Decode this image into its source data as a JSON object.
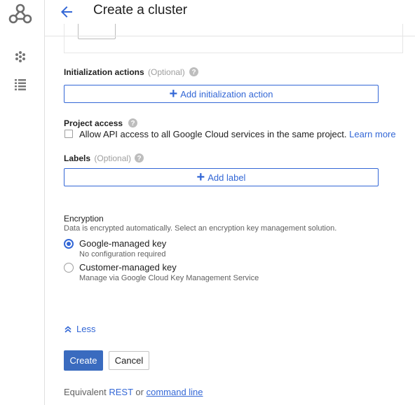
{
  "header": {
    "title": "Create a cluster"
  },
  "init_actions": {
    "label": "Initialization actions",
    "optional": "(Optional)",
    "button": "Add initialization action"
  },
  "project_access": {
    "label": "Project access",
    "checkbox_text": "Allow API access to all Google Cloud services in the same project.",
    "learn_more": "Learn more",
    "checked": false
  },
  "labels": {
    "label": "Labels",
    "optional": "(Optional)",
    "button": "Add label"
  },
  "encryption": {
    "label": "Encryption",
    "description": "Data is encrypted automatically. Select an encryption key management solution.",
    "options": [
      {
        "label": "Google-managed key",
        "sub": "No configuration required",
        "selected": true
      },
      {
        "label": "Customer-managed key",
        "sub": "Manage via Google Cloud Key Management Service",
        "selected": false
      }
    ]
  },
  "less_label": "Less",
  "actions": {
    "create": "Create",
    "cancel": "Cancel"
  },
  "equivalent": {
    "prefix": "Equivalent",
    "rest": "REST",
    "or": "or",
    "command_line": "command line"
  },
  "colors": {
    "accent": "#3367d6",
    "primary_button": "#3a6bbf",
    "icon_gray": "#757575"
  },
  "icons": {
    "logo": "dataproc-logo-icon",
    "nav1": "clusters-icon",
    "nav2": "jobs-list-icon",
    "back": "arrow-back-icon",
    "help": "help-icon",
    "expand": "chevron-up-icon"
  }
}
